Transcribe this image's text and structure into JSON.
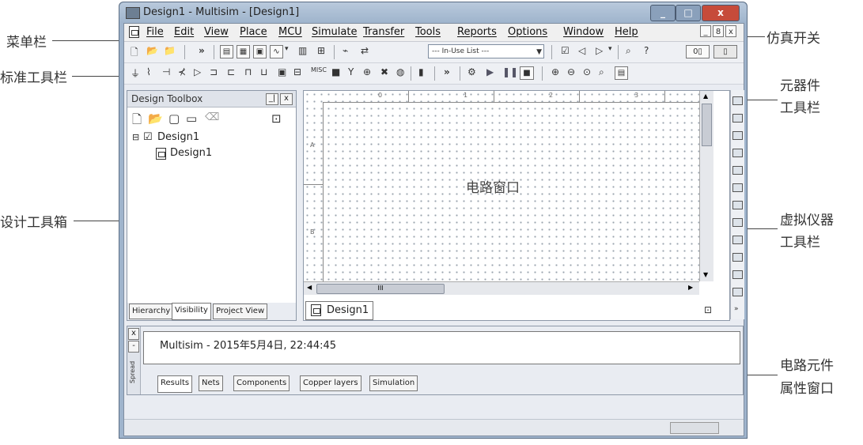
{
  "window": {
    "title": "Design1 - Multisim - [Design1]",
    "controls": [
      "_",
      "□",
      "x"
    ]
  },
  "menu": {
    "items": [
      "File",
      "Edit",
      "View",
      "Place",
      "MCU",
      "Simulate",
      "Transfer",
      "Tools",
      "Reports",
      "Options",
      "Window",
      "Help"
    ],
    "mdi_controls": [
      "_",
      "8",
      "x"
    ]
  },
  "toolbar": {
    "in_use_list": "--- In-Use List ---",
    "overflow": "»"
  },
  "design_toolbox": {
    "title": "Design Toolbox",
    "tree": [
      "Design1",
      "Design1"
    ],
    "tabs": [
      "Hierarchy",
      "Visibility",
      "Project View"
    ],
    "header_controls": [
      "_|",
      "x"
    ]
  },
  "circuit": {
    "label": "电路窗口",
    "ruler_top": [
      "0",
      "1",
      "2",
      "3"
    ],
    "ruler_left": [
      "A",
      "B"
    ],
    "scroll_thumb": "III",
    "document_tab": "Design1"
  },
  "results": {
    "message": "Multisim  -  2015年5月4日, 22:44:45",
    "tabs": [
      "Results",
      "Nets",
      "Components",
      "Copper layers",
      "Simulation"
    ],
    "side_label": "Spread"
  },
  "annotations": {
    "menu_bar": "菜单栏",
    "standard_toolbar": "标准工具栏",
    "design_toolbox": "设计工具箱",
    "sim_switch": "仿真开关",
    "component_toolbar": [
      "元器件",
      "工具栏"
    ],
    "virtual_instrument_toolbar": [
      "虚拟仪器",
      "工具栏"
    ],
    "properties_window": [
      "电路元件",
      "属性窗口"
    ]
  }
}
